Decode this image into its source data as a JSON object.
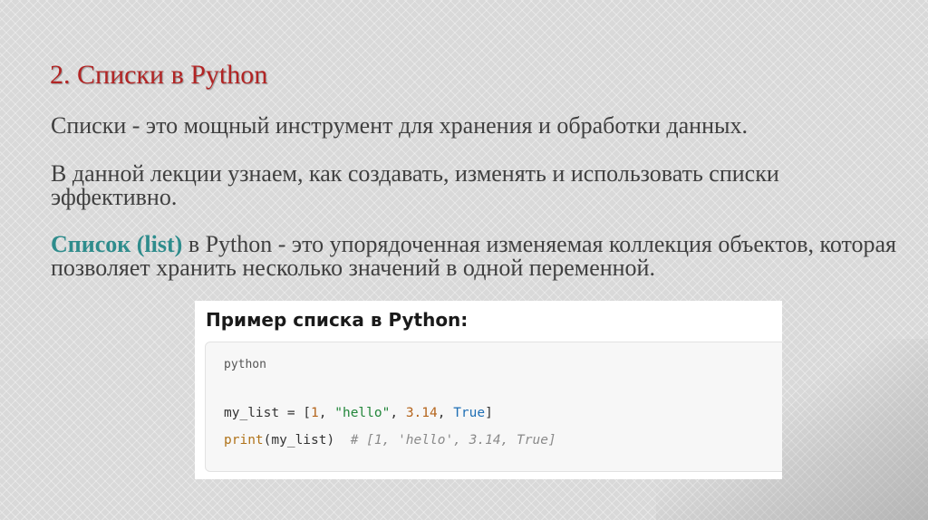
{
  "slide": {
    "title": "2. Списки в Python",
    "intro": "Списки - это мощный инструмент для хранения и обработки данных.",
    "lecture_goal": "В данной лекции узнаем, как создавать, изменять и использовать списки эффективно.",
    "definition_term": "Список (list)",
    "definition_text": " в Python - это упорядоченная изменяемая коллекция объектов, которая позволяет хранить несколько значений в одной переменной."
  },
  "code_example": {
    "heading": "Пример списка в Python:",
    "language": "python",
    "line1": {
      "var": "my_list = [",
      "n1": "1",
      "sep1": ", ",
      "s1": "\"hello\"",
      "sep2": ", ",
      "n2": "3.14",
      "sep3": ", ",
      "kw": "True",
      "end": "]"
    },
    "line2": {
      "fn": "print",
      "args": "(my_list)  ",
      "comment": "# [1, 'hello', 3.14, True]"
    }
  },
  "colors": {
    "title": "#b22424",
    "term": "#2e8c8c",
    "body_text": "#404040"
  }
}
